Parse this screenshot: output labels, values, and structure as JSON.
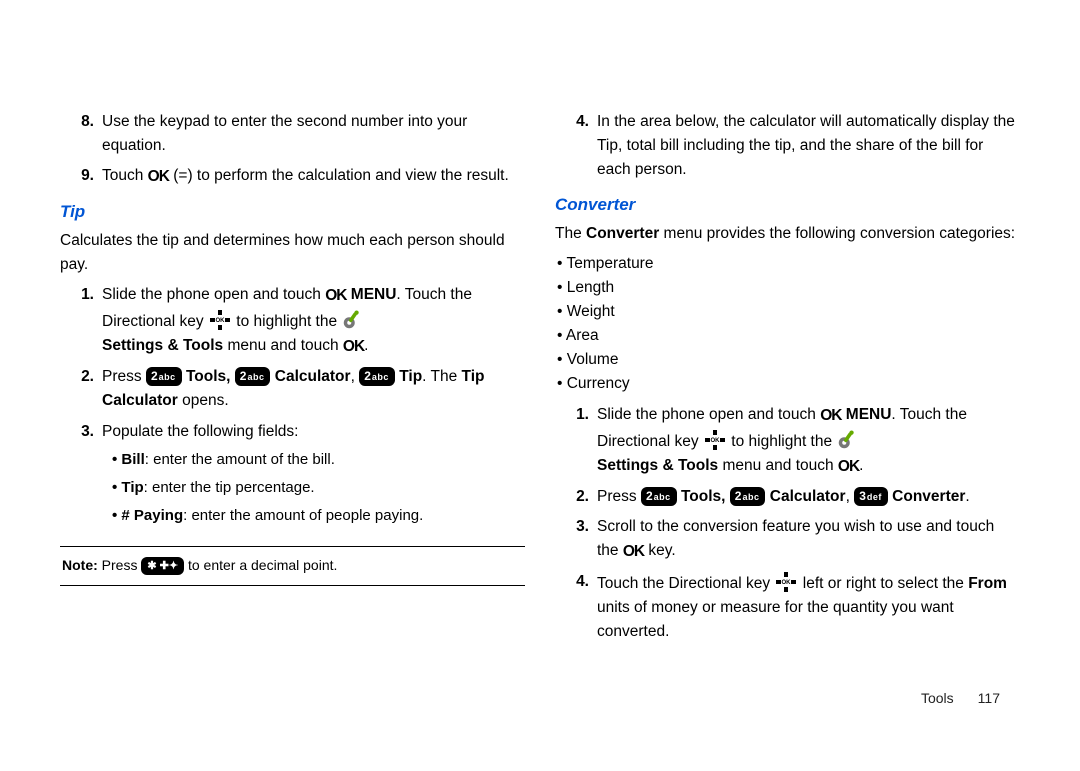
{
  "left": {
    "steps_top": [
      {
        "n": "8.",
        "text": "Use the keypad to enter the second number into your equation."
      },
      {
        "n": "9.",
        "pre": "Touch ",
        "post": " (=) to perform the calculation and view the result."
      }
    ],
    "tip_heading": "Tip",
    "tip_intro": "Calculates the tip and determines how much each person should pay.",
    "tip_steps": {
      "s1": {
        "n": "1.",
        "a": "Slide the phone open and touch ",
        "menu": "MENU",
        "b": ". Touch the Directional key ",
        "c": " to highlight the ",
        "d": "Settings & Tools",
        "e": " menu and touch "
      },
      "s2": {
        "n": "2.",
        "a": "Press ",
        "tools": " Tools, ",
        "calc": " Calculator",
        "comma": ", ",
        "tip": " Tip",
        "b": ". The ",
        "opens": "Tip Calculator",
        "c": " opens."
      },
      "s3": {
        "n": "3.",
        "a": "Populate the following fields:"
      }
    },
    "sub": {
      "bill_l": "Bill",
      "bill_t": ": enter the amount of the bill.",
      "tip_l": "Tip",
      "tip_t": ": enter the tip percentage.",
      "pay_l": "# Paying",
      "pay_t": ": enter the amount of people paying."
    },
    "note": {
      "a": "Note:",
      "b": " Press ",
      "c": " to enter a decimal point."
    }
  },
  "right": {
    "step4": {
      "n": "4.",
      "text": "In the area below, the calculator will automatically display the Tip, total bill including the tip, and the share of the bill for each person."
    },
    "conv_heading": "Converter",
    "conv_intro_a": "The ",
    "conv_intro_b": "Converter",
    "conv_intro_c": " menu provides the following conversion categories:",
    "cats": [
      "Temperature",
      "Length",
      "Weight",
      "Area",
      "Volume",
      "Currency"
    ],
    "steps": {
      "s1": {
        "n": "1.",
        "a": "Slide the phone open and touch ",
        "menu": "MENU",
        "b": ". Touch the Directional key ",
        "c": " to highlight the ",
        "d": "Settings & Tools",
        "e": " menu and touch "
      },
      "s2": {
        "n": "2.",
        "a": "Press ",
        "tools": " Tools, ",
        "calc": " Calculator",
        "comma": ", ",
        "conv": " Converter",
        "dot": "."
      },
      "s3": {
        "n": "3.",
        "a": "Scroll to the conversion feature you wish to use and touch the ",
        "b": " key."
      },
      "s4": {
        "n": "4.",
        "a": "Touch the Directional key ",
        "b": " left or right to select the ",
        "from": "From",
        "c": " units of money or measure for the quantity you want converted."
      }
    }
  },
  "keys": {
    "two_num": "2",
    "two_abc": "abc",
    "three_num": "3",
    "three_abc": "def",
    "star": "✱ ✚✦"
  },
  "icons": {
    "ok": "OK"
  },
  "footer": {
    "section": "Tools",
    "page": "117"
  }
}
